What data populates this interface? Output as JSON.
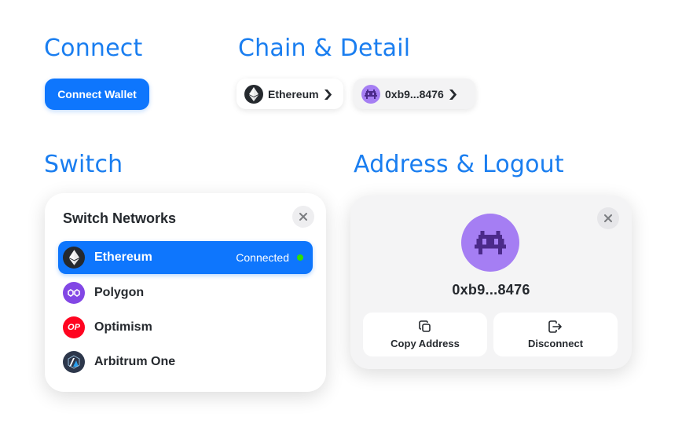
{
  "sections": {
    "connect": "Connect",
    "chain_detail": "Chain & Detail",
    "switch": "Switch",
    "address_logout": "Address & Logout"
  },
  "connect_button": {
    "label": "Connect Wallet"
  },
  "chain_pill": {
    "label": "Ethereum",
    "icon": "ethereum-icon"
  },
  "account_pill": {
    "label": "0xb9...8476",
    "icon": "avatar-icon"
  },
  "switch_modal": {
    "title": "Switch Networks",
    "networks": [
      {
        "name": "Ethereum",
        "status": "Connected",
        "active": true,
        "icon": "ethereum-icon",
        "color": "#25292e"
      },
      {
        "name": "Polygon",
        "icon": "polygon-icon",
        "color": "#8247e5"
      },
      {
        "name": "Optimism",
        "icon": "optimism-icon",
        "color": "#ff0420",
        "icon_text": "OP"
      },
      {
        "name": "Arbitrum One",
        "icon": "arbitrum-icon",
        "color": "#2d374b"
      }
    ]
  },
  "account_modal": {
    "address": "0xb9...8476",
    "copy_label": "Copy Address",
    "disconnect_label": "Disconnect"
  },
  "colors": {
    "accent": "#0e76fd",
    "title": "#1a7ef0",
    "connected_dot": "#30e000",
    "avatar_bg": "#a57ef3"
  }
}
